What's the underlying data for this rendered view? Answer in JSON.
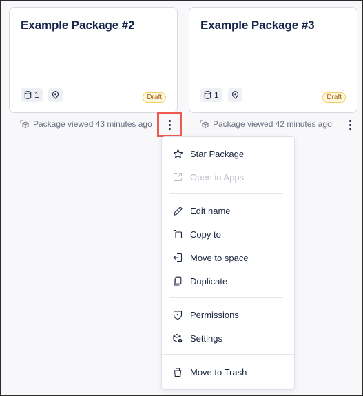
{
  "cards": [
    {
      "title": "Example Package #2",
      "datasource_count": "1",
      "status_badge": "Draft",
      "viewed_text": "Package viewed 43 minutes ago"
    },
    {
      "title": "Example Package #3",
      "datasource_count": "1",
      "status_badge": "Draft",
      "viewed_text": "Package viewed 42 minutes ago"
    }
  ],
  "menu": {
    "items": [
      {
        "label": "Star Package",
        "icon": "star-icon",
        "disabled": false
      },
      {
        "label": "Open in Apps",
        "icon": "external-link-icon",
        "disabled": true
      },
      {
        "label": "Edit name",
        "icon": "pencil-icon",
        "disabled": false
      },
      {
        "label": "Copy to",
        "icon": "copy-icon",
        "disabled": false
      },
      {
        "label": "Move to space",
        "icon": "move-in-icon",
        "disabled": false
      },
      {
        "label": "Duplicate",
        "icon": "duplicate-icon",
        "disabled": false
      },
      {
        "label": "Permissions",
        "icon": "shield-icon",
        "disabled": false
      },
      {
        "label": "Settings",
        "icon": "package-settings-icon",
        "disabled": false
      },
      {
        "label": "Move to Trash",
        "icon": "trash-icon",
        "disabled": false
      }
    ]
  },
  "colors": {
    "highlight": "#ee5a4f",
    "draft_border": "#f3cf5c",
    "draft_text": "#a4661a",
    "title": "#14244a"
  }
}
